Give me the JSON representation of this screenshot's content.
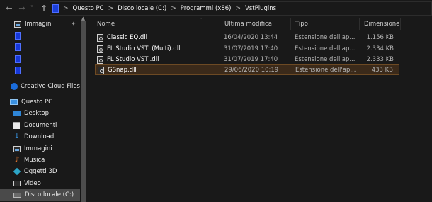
{
  "address": {
    "breadcrumbs": [
      "Questo PC",
      "Disco locale (C:)",
      "Programmi (x86)",
      "VstPlugins"
    ],
    "separator": ">"
  },
  "nav": {
    "pinned_label": "Immagini",
    "items": [
      {
        "label": "Creative Cloud Files"
      },
      {
        "label": "Questo PC"
      },
      {
        "label": "Desktop"
      },
      {
        "label": "Documenti"
      },
      {
        "label": "Download"
      },
      {
        "label": "Immagini"
      },
      {
        "label": "Musica"
      },
      {
        "label": "Oggetti 3D"
      },
      {
        "label": "Video"
      },
      {
        "label": "Disco locale (C:)"
      }
    ],
    "selected": "Disco locale (C:)"
  },
  "columns": {
    "name": "Nome",
    "modified": "Ultima modifica",
    "type": "Tipo",
    "size": "Dimensione"
  },
  "files": [
    {
      "name": "Classic EQ.dll",
      "modified": "16/04/2020 13:44",
      "type": "Estensione dell'ap...",
      "size": "1.156 KB"
    },
    {
      "name": "FL Studio VSTi (Multi).dll",
      "modified": "31/07/2019 17:40",
      "type": "Estensione dell'ap...",
      "size": "2.334 KB"
    },
    {
      "name": "FL Studio VSTi.dll",
      "modified": "31/07/2019 17:40",
      "type": "Estensione dell'ap...",
      "size": "2.333 KB"
    },
    {
      "name": "GSnap.dll",
      "modified": "29/06/2020 10:19",
      "type": "Estensione dell'ap...",
      "size": "433 KB",
      "highlighted": true
    }
  ],
  "colors": {
    "background": "#191919",
    "highlight_bg": "#3b2a1a",
    "highlight_border": "#6d4a24",
    "selected_nav": "#4a4a4a",
    "accent_blue": "#1638d8"
  }
}
